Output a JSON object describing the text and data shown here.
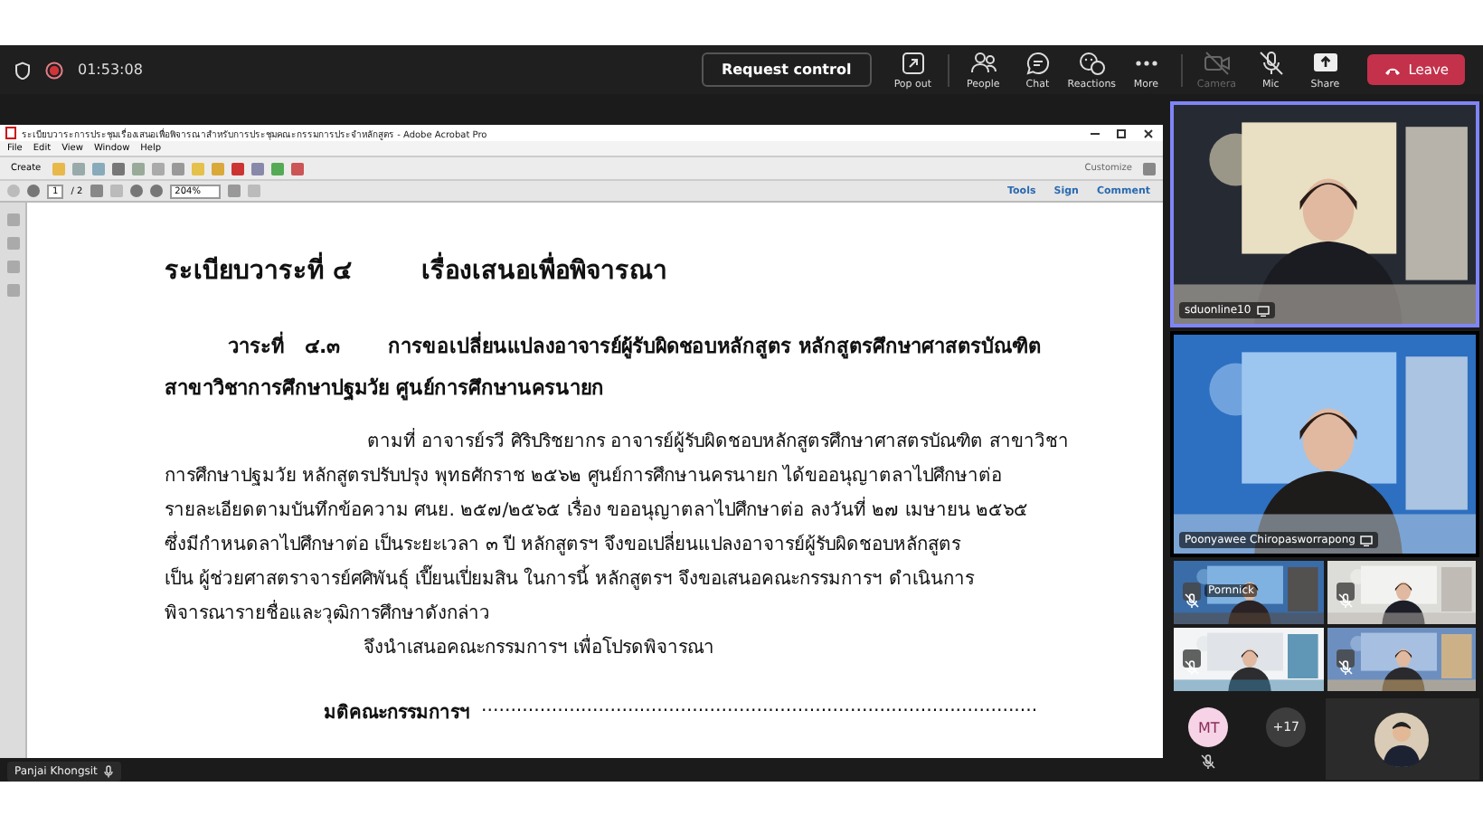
{
  "meeting_bar": {
    "timer": "01:53:08",
    "recording": true,
    "request_control": "Request control",
    "actions": [
      {
        "label": "Pop out",
        "kind": "popout",
        "off": false,
        "disabled": false
      },
      {
        "label": "People",
        "kind": "people",
        "off": false,
        "disabled": false
      },
      {
        "label": "Chat",
        "kind": "chat",
        "off": false,
        "disabled": false
      },
      {
        "label": "Reactions",
        "kind": "reactions",
        "off": false,
        "disabled": false
      },
      {
        "label": "More",
        "kind": "more",
        "off": false,
        "disabled": false
      },
      {
        "label": "Camera",
        "kind": "camera",
        "off": true,
        "disabled": true
      },
      {
        "label": "Mic",
        "kind": "mic",
        "off": true,
        "disabled": false
      },
      {
        "label": "Share",
        "kind": "share",
        "off": false,
        "disabled": false
      }
    ],
    "leave": "Leave"
  },
  "shared_window": {
    "title": "ระเบียบวาระการประชุมเรื่องเสนอเพื่อพิจารณาสำหรับการประชุมคณะกรรมการประจำหลักสูตร - Adobe Acrobat Pro",
    "menu": [
      "File",
      "Edit",
      "View",
      "Window",
      "Help"
    ],
    "create": "Create",
    "page": "1",
    "page_total": "/ 2",
    "zoom": "204%",
    "customize": "Customize",
    "panes": [
      "Tools",
      "Sign",
      "Comment"
    ],
    "document": {
      "agenda_no": "ระเบียบวาระที่ ๔",
      "agenda_title": "เรื่องเสนอเพื่อพิจารณา",
      "item_no": "วาระที่   ๔.๓",
      "item_title": [
        "การขอเปลี่ยนแปลงอาจารย์ผู้รับผิดชอบหลักสูตร หลักสูตรศึกษาศาสตรบัณฑิต",
        "สาขาวิชาการศึกษาปฐมวัย ศูนย์การศึกษานครนายก"
      ],
      "body": [
        "ตามที่ อาจารย์รวี ศิริปริชยากร  อาจารย์ผู้รับผิดชอบหลักสูตรศึกษาศาสตรบัณฑิต สาขาวิชา",
        "การศึกษาปฐมวัย หลักสูตรปรับปรุง พุทธศักราช ๒๕๖๒ ศูนย์การศึกษานครนายก ได้ขออนุญาตลาไปศึกษาต่อ",
        "รายละเอียดตามบันทึกข้อความ ศนย. ๒๕๗/๒๕๖๕ เรื่อง ขออนุญาตลาไปศึกษาต่อ ลงวันที่ ๒๗ เมษายน ๒๕๖๕",
        "ซึ่งมีกำหนดลาไปศึกษาต่อ เป็นระยะเวลา ๓ ปี หลักสูตรฯ จึงขอเปลี่ยนแปลงอาจารย์ผู้รับผิดชอบหลักสูตร",
        "เป็น ผู้ช่วยศาสตราจารย์ศศิพันธุ์ เปี๊ยนเปี่ยมสิน ในการนี้ หลักสูตรฯ จึงขอเสนอคณะกรรมการฯ ดำเนินการ",
        "พิจารณารายชื่อและวุฒิการศึกษาดังกล่าว"
      ],
      "closing": "จึงนำเสนอคณะกรรมการฯ เพื่อโปรดพิจารณา",
      "resolution_label": "มติคณะกรรมการฯ",
      "resolution_line": "..............................................................................................."
    }
  },
  "presenter": {
    "name": "Panjai Khongsit"
  },
  "video_panel": {
    "large_tiles": [
      {
        "name": "sduonline10",
        "speaking": true,
        "kind": "picture"
      },
      {
        "name": "Poonyawee Chiropasworrapong",
        "speaking": false,
        "kind": "picture"
      }
    ],
    "small_tiles": [
      {
        "name": "Pornnick",
        "muted": true,
        "kind": "picture"
      },
      {
        "muted": true,
        "kind": "picture"
      },
      {
        "muted": true,
        "kind": "picture"
      },
      {
        "muted": true,
        "kind": "picture"
      }
    ],
    "avatar": {
      "initials": "MT",
      "muted": true
    },
    "overflow": "+17"
  }
}
